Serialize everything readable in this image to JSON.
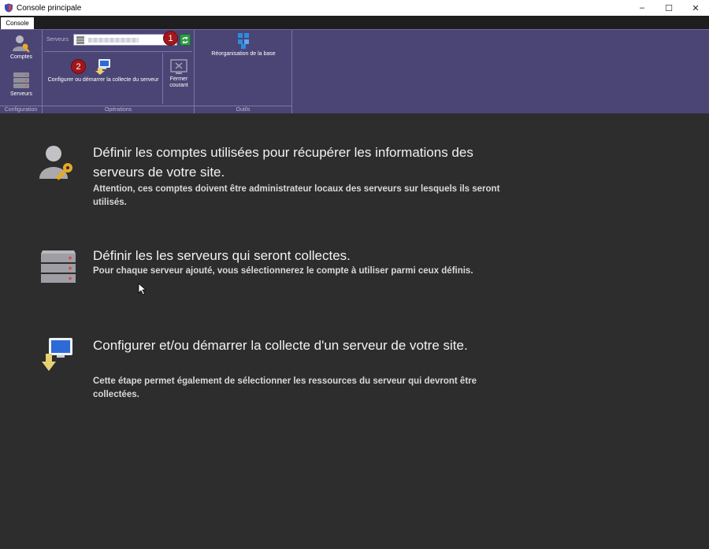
{
  "window": {
    "title": "Console principale",
    "minimize": "–",
    "maximize": "☐",
    "close": "✕"
  },
  "tabs": [
    {
      "label": "Console"
    }
  ],
  "ribbon": {
    "groups": {
      "configuration": {
        "label": "Configuration",
        "buttons": [
          {
            "label": "Comptes"
          },
          {
            "label": "Serveurs"
          }
        ]
      },
      "operations": {
        "label": "Opérations",
        "server_label": "Serveurs",
        "configure_label": "Configurer ou démarrer la collecte du serveur",
        "close_label": "Fermer courant"
      },
      "outils": {
        "label": "Outils",
        "reorg_label": "Réorganisation de la base"
      }
    },
    "badges": [
      "1",
      "2"
    ]
  },
  "main": {
    "items": [
      {
        "heading": "Définir les comptes utilisées pour récupérer les informations des serveurs de votre site.",
        "description": "Attention, ces comptes doivent être administrateur locaux des serveurs sur lesquels ils seront utilisés."
      },
      {
        "heading": "Définir les les serveurs qui seront collectes.",
        "description": "Pour chaque serveur ajouté, vous sélectionnerez le compte à utiliser parmi ceux définis."
      },
      {
        "heading": "Configurer et/ou démarrer la collecte d'un serveur de votre site.",
        "description": "Cette étape permet également de sélectionner les ressources du serveur qui devront être collectées."
      }
    ]
  },
  "colors": {
    "ribbon": "#4a4574",
    "background": "#2d2d2d",
    "badge": "#a3161c",
    "refresh": "#2f9b4a"
  }
}
